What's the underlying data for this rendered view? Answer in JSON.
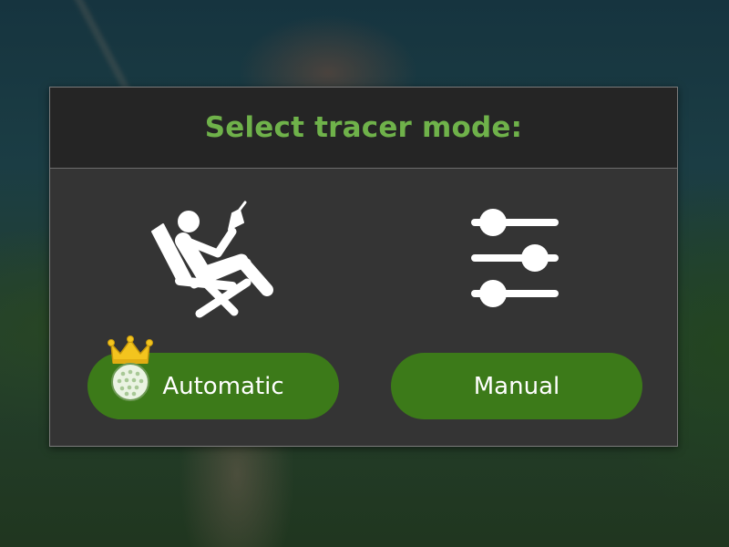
{
  "dialog": {
    "title": "Select tracer mode:"
  },
  "options": [
    {
      "id": "automatic",
      "label": "Automatic",
      "icon": "reclining-golfer-icon",
      "badge": "premium-crown-golf-ball-icon"
    },
    {
      "id": "manual",
      "label": "Manual",
      "icon": "sliders-icon"
    }
  ],
  "colors": {
    "title": "#6fb24a",
    "button_bg": "#3c7a19",
    "dialog_bg": "#343434",
    "header_bg": "#252525",
    "crown": "#f3c41e"
  }
}
